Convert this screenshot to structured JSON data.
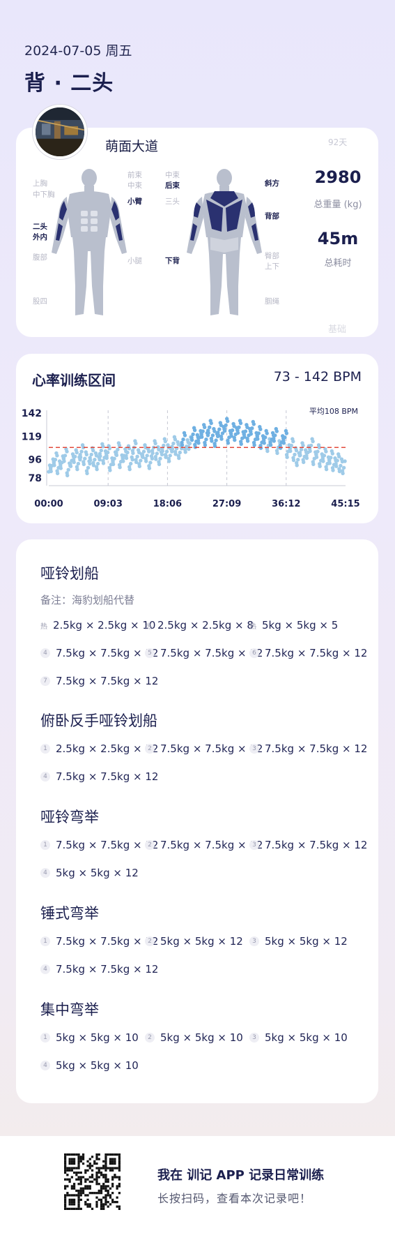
{
  "header": {
    "date": "2024-07-05 周五",
    "title": "背 · 二头"
  },
  "profile": {
    "name": "萌面大道",
    "days": "92天"
  },
  "muscles": {
    "front": [
      {
        "label": "上胸",
        "hl": false
      },
      {
        "label": "中下胸",
        "hl": false
      },
      {
        "label": "二头",
        "hl": true
      },
      {
        "label": "外内",
        "hl": true
      },
      {
        "label": "腹部",
        "hl": false
      },
      {
        "label": "股四",
        "hl": false
      },
      {
        "label": "前束",
        "hl": false
      },
      {
        "label": "中束",
        "hl": false
      },
      {
        "label": "小臂",
        "hl": true
      },
      {
        "label": "小腿",
        "hl": false
      }
    ],
    "back": [
      {
        "label": "中束",
        "hl": false
      },
      {
        "label": "后束",
        "hl": true
      },
      {
        "label": "三头",
        "hl": false
      },
      {
        "label": "下背",
        "hl": true
      },
      {
        "label": "斜方",
        "hl": true
      },
      {
        "label": "背部",
        "hl": true
      },
      {
        "label": "臀部",
        "hl": false
      },
      {
        "label": "上下",
        "hl": false
      },
      {
        "label": "腘绳",
        "hl": false
      }
    ]
  },
  "stats": {
    "weight_value": "2980",
    "weight_label": "总重量 (kg)",
    "time_value": "45m",
    "time_label": "总耗时",
    "watermark": "基础"
  },
  "heart_rate": {
    "title": "心率训练区间",
    "range": "73 - 142 BPM",
    "avg_label": "平均108 BPM",
    "colors": {
      "point": "#9fcbe8",
      "point_dark": "#6fb0e2",
      "avg_line": "#e24a3b"
    }
  },
  "chart_data": {
    "type": "scatter",
    "title": "心率训练区间",
    "xlabel": "",
    "ylabel": "",
    "x_ticks": [
      "00:00",
      "09:03",
      "18:06",
      "27:09",
      "36:12",
      "45:15"
    ],
    "y_ticks": [
      142,
      119,
      96,
      78
    ],
    "ylim": [
      73,
      142
    ],
    "xlim": [
      0,
      45.25
    ],
    "avg": 108,
    "series": [
      {
        "x": [
          0.0,
          0.5,
          1.0,
          1.5,
          2.0,
          2.5,
          3.0,
          3.5,
          4.0,
          4.5,
          5.0,
          5.5,
          6.0,
          6.5,
          7.0,
          7.5,
          8.0,
          8.5,
          9.0,
          9.5,
          10.0,
          10.5,
          11.0,
          11.5,
          12.0,
          12.5,
          13.0,
          13.5,
          14.0,
          14.5,
          15.0,
          15.5,
          16.0,
          16.5,
          17.0,
          17.5,
          18.0,
          18.5,
          19.0,
          19.5,
          20.0,
          20.5,
          21.0,
          21.5,
          22.0,
          22.5,
          23.0,
          23.5,
          24.0,
          24.5,
          25.0,
          25.5,
          26.0,
          26.5,
          27.0,
          27.5,
          28.0,
          28.5,
          29.0,
          29.5,
          30.0,
          30.5,
          31.0,
          31.5,
          32.0,
          32.5,
          33.0,
          33.5,
          34.0,
          34.5,
          35.0,
          35.5,
          36.0,
          36.5,
          37.0,
          37.5,
          38.0,
          38.5,
          39.0,
          39.5,
          40.0,
          40.5,
          41.0,
          41.5,
          42.0,
          42.5,
          43.0,
          43.5,
          44.0,
          44.5,
          45.0
        ],
        "y": [
          84,
          90,
          96,
          88,
          93,
          100,
          86,
          95,
          99,
          92,
          104,
          97,
          88,
          101,
          96,
          92,
          105,
          98,
          103,
          91,
          97,
          106,
          94,
          100,
          103,
          92,
          108,
          99,
          95,
          104,
          100,
          93,
          108,
          102,
          97,
          110,
          104,
          100,
          112,
          107,
          103,
          116,
          109,
          112,
          121,
          114,
          118,
          124,
          116,
          128,
          120,
          115,
          126,
          122,
          130,
          118,
          125,
          121,
          128,
          117,
          124,
          120,
          127,
          116,
          122,
          113,
          118,
          110,
          116,
          120,
          108,
          113,
          118,
          104,
          110,
          101,
          96,
          106,
          99,
          103,
          110,
          97,
          104,
          95,
          100,
          92,
          98,
          91,
          95,
          90,
          88
        ]
      }
    ]
  },
  "exercises": [
    {
      "name": "哑铃划船",
      "note": "备注：海豹划船代替",
      "sets": [
        {
          "idx": "热",
          "warm": true,
          "text": "2.5kg × 2.5kg × 10"
        },
        {
          "idx": "热",
          "warm": true,
          "text": "2.5kg × 2.5kg × 8"
        },
        {
          "idx": "热",
          "warm": true,
          "text": "5kg × 5kg × 5"
        },
        {
          "idx": "4",
          "warm": false,
          "text": "7.5kg × 7.5kg × 12"
        },
        {
          "idx": "5",
          "warm": false,
          "text": "7.5kg × 7.5kg × 12"
        },
        {
          "idx": "6",
          "warm": false,
          "text": "7.5kg × 7.5kg × 12"
        },
        {
          "idx": "7",
          "warm": false,
          "text": "7.5kg × 7.5kg × 12"
        }
      ]
    },
    {
      "name": "俯卧反手哑铃划船",
      "note": "",
      "sets": [
        {
          "idx": "1",
          "warm": false,
          "text": "2.5kg × 2.5kg × 12"
        },
        {
          "idx": "2",
          "warm": false,
          "text": "7.5kg × 7.5kg × 12"
        },
        {
          "idx": "3",
          "warm": false,
          "text": "7.5kg × 7.5kg × 12"
        },
        {
          "idx": "4",
          "warm": false,
          "text": "7.5kg × 7.5kg × 12"
        }
      ]
    },
    {
      "name": "哑铃弯举",
      "note": "",
      "sets": [
        {
          "idx": "1",
          "warm": false,
          "text": "7.5kg × 7.5kg × 12"
        },
        {
          "idx": "2",
          "warm": false,
          "text": "7.5kg × 7.5kg × 12"
        },
        {
          "idx": "3",
          "warm": false,
          "text": "7.5kg × 7.5kg × 12"
        },
        {
          "idx": "4",
          "warm": false,
          "text": "5kg × 5kg × 12"
        }
      ]
    },
    {
      "name": "锤式弯举",
      "note": "",
      "sets": [
        {
          "idx": "1",
          "warm": false,
          "text": "7.5kg × 7.5kg × 12"
        },
        {
          "idx": "2",
          "warm": false,
          "text": "5kg × 5kg × 12"
        },
        {
          "idx": "3",
          "warm": false,
          "text": "5kg × 5kg × 12"
        },
        {
          "idx": "4",
          "warm": false,
          "text": "7.5kg × 7.5kg × 12"
        }
      ]
    },
    {
      "name": "集中弯举",
      "note": "",
      "sets": [
        {
          "idx": "1",
          "warm": false,
          "text": "5kg × 5kg × 10"
        },
        {
          "idx": "2",
          "warm": false,
          "text": "5kg × 5kg × 10"
        },
        {
          "idx": "3",
          "warm": false,
          "text": "5kg × 5kg × 10"
        },
        {
          "idx": "4",
          "warm": false,
          "text": "5kg × 5kg × 10"
        }
      ]
    }
  ],
  "footer": {
    "main": "我在 训记 APP 记录日常训练",
    "sub": "长按扫码，查看本次记录吧！",
    "qr_icon": "qr-code-icon"
  }
}
